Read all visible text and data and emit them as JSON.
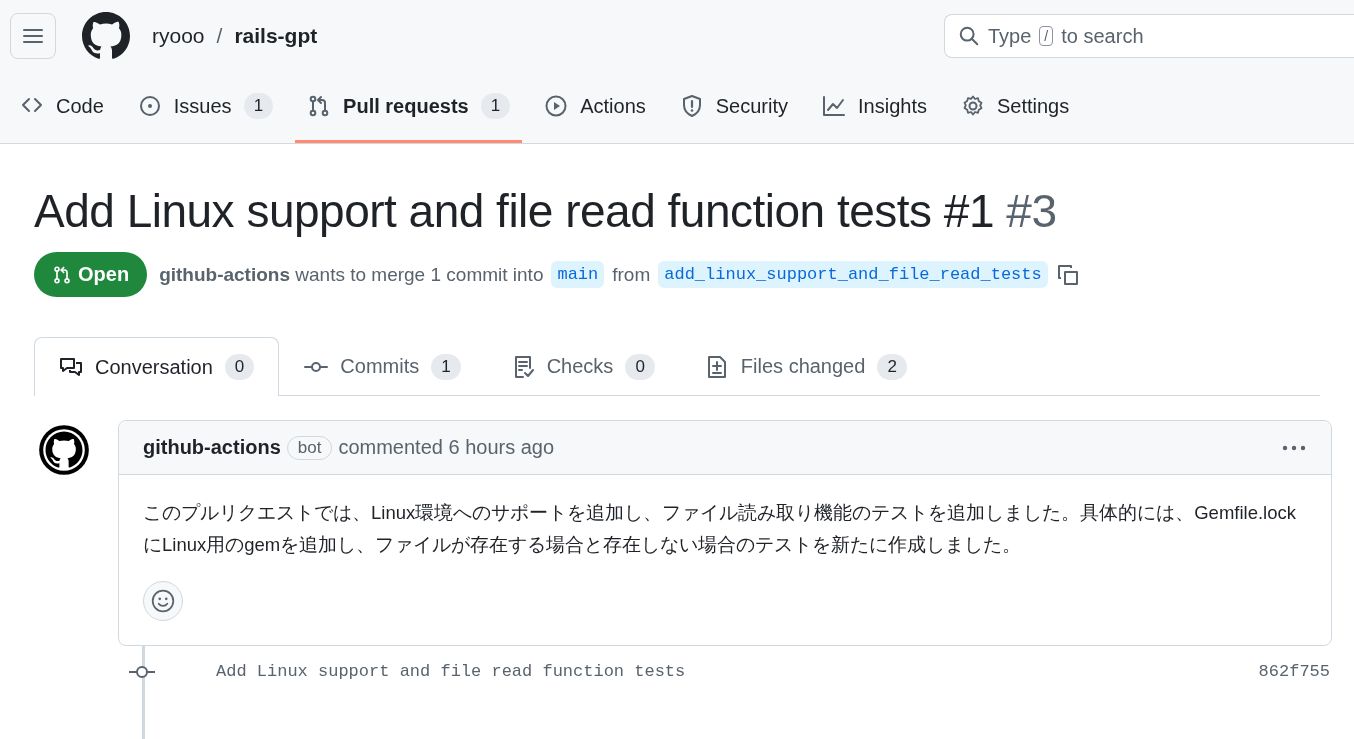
{
  "header": {
    "owner": "ryooo",
    "separator": "/",
    "repo": "rails-gpt",
    "search": {
      "placeholder_start": "Type",
      "key": "/",
      "placeholder_end": "to search"
    }
  },
  "repo_tabs": [
    {
      "label": "Code",
      "kind": "code",
      "selected": false
    },
    {
      "label": "Issues",
      "kind": "issue",
      "counter": "1",
      "selected": false
    },
    {
      "label": "Pull requests",
      "kind": "pull",
      "counter": "1",
      "selected": true
    },
    {
      "label": "Actions",
      "kind": "play",
      "selected": false
    },
    {
      "label": "Security",
      "kind": "shield",
      "selected": false
    },
    {
      "label": "Insights",
      "kind": "graph",
      "selected": false
    },
    {
      "label": "Settings",
      "kind": "gear",
      "selected": false
    }
  ],
  "pull_request": {
    "title": "Add Linux support and file read function tests #1",
    "number": "#3",
    "state": "Open",
    "author": "github-actions",
    "merge_text": "wants to merge 1 commit into",
    "base": "main",
    "from_text": "from",
    "head": "add_linux_support_and_file_read_tests"
  },
  "pr_tabs": [
    {
      "label": "Conversation",
      "kind": "conversation",
      "counter": "0",
      "selected": true
    },
    {
      "label": "Commits",
      "kind": "commit",
      "counter": "1",
      "selected": false
    },
    {
      "label": "Checks",
      "kind": "checks",
      "counter": "0",
      "selected": false
    },
    {
      "label": "Files changed",
      "kind": "diff",
      "counter": "2",
      "selected": false
    }
  ],
  "comment": {
    "author": "github-actions",
    "badge": "bot",
    "meta": "commented 6 hours ago",
    "body": "このプルリクエストでは、Linux環境へのサポートを追加し、ファイル読み取り機能のテストを追加しました。具体的には、Gemfile.lockにLinux用のgemを追加し、ファイルが存在する場合と存在しない場合のテストを新たに作成しました。"
  },
  "commits": [
    {
      "message": "Add Linux support and file read function tests",
      "sha": "862f755"
    }
  ]
}
